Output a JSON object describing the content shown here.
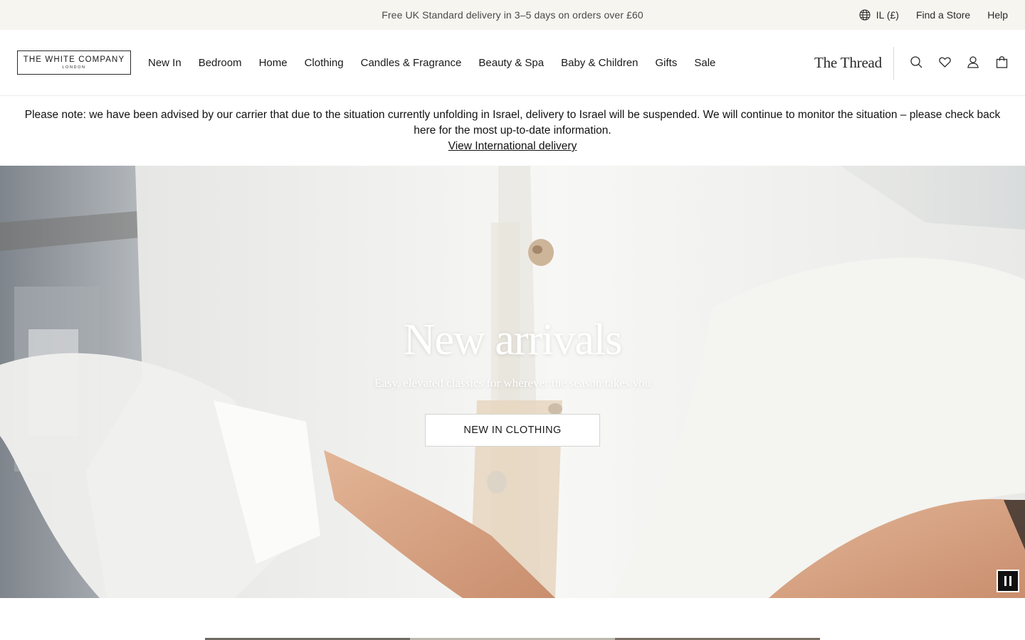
{
  "utility": {
    "promo": "Free UK Standard delivery in 3–5 days on orders over £60",
    "region": "IL (£)",
    "find_store": "Find a Store",
    "help": "Help"
  },
  "header": {
    "logo_main": "THE WHITE COMPANY",
    "logo_sub": "LONDON",
    "nav": [
      "New In",
      "Bedroom",
      "Home",
      "Clothing",
      "Candles & Fragrance",
      "Beauty & Spa",
      "Baby & Children",
      "Gifts",
      "Sale"
    ],
    "thread_link": "The Thread",
    "icons": [
      "search-icon",
      "heart-icon",
      "account-icon",
      "bag-icon"
    ]
  },
  "notice": {
    "text": "Please note: we have been advised by our carrier that due to the situation currently unfolding in Israel, delivery to Israel will be suspended. We will continue to monitor the situation – please check back here for the most up-to-date information.",
    "link": "View International delivery"
  },
  "hero": {
    "title": "New arrivals",
    "subtitle": "Easy, elevated classics for wherever the season takes you",
    "cta": "NEW IN CLOTHING",
    "pause_icon": "pause-icon"
  },
  "colors": {
    "utility_bg": "#f6f5f0",
    "text": "#1a1a1a",
    "cta_bg": "#ffffff",
    "pause_bg": "#111111"
  }
}
